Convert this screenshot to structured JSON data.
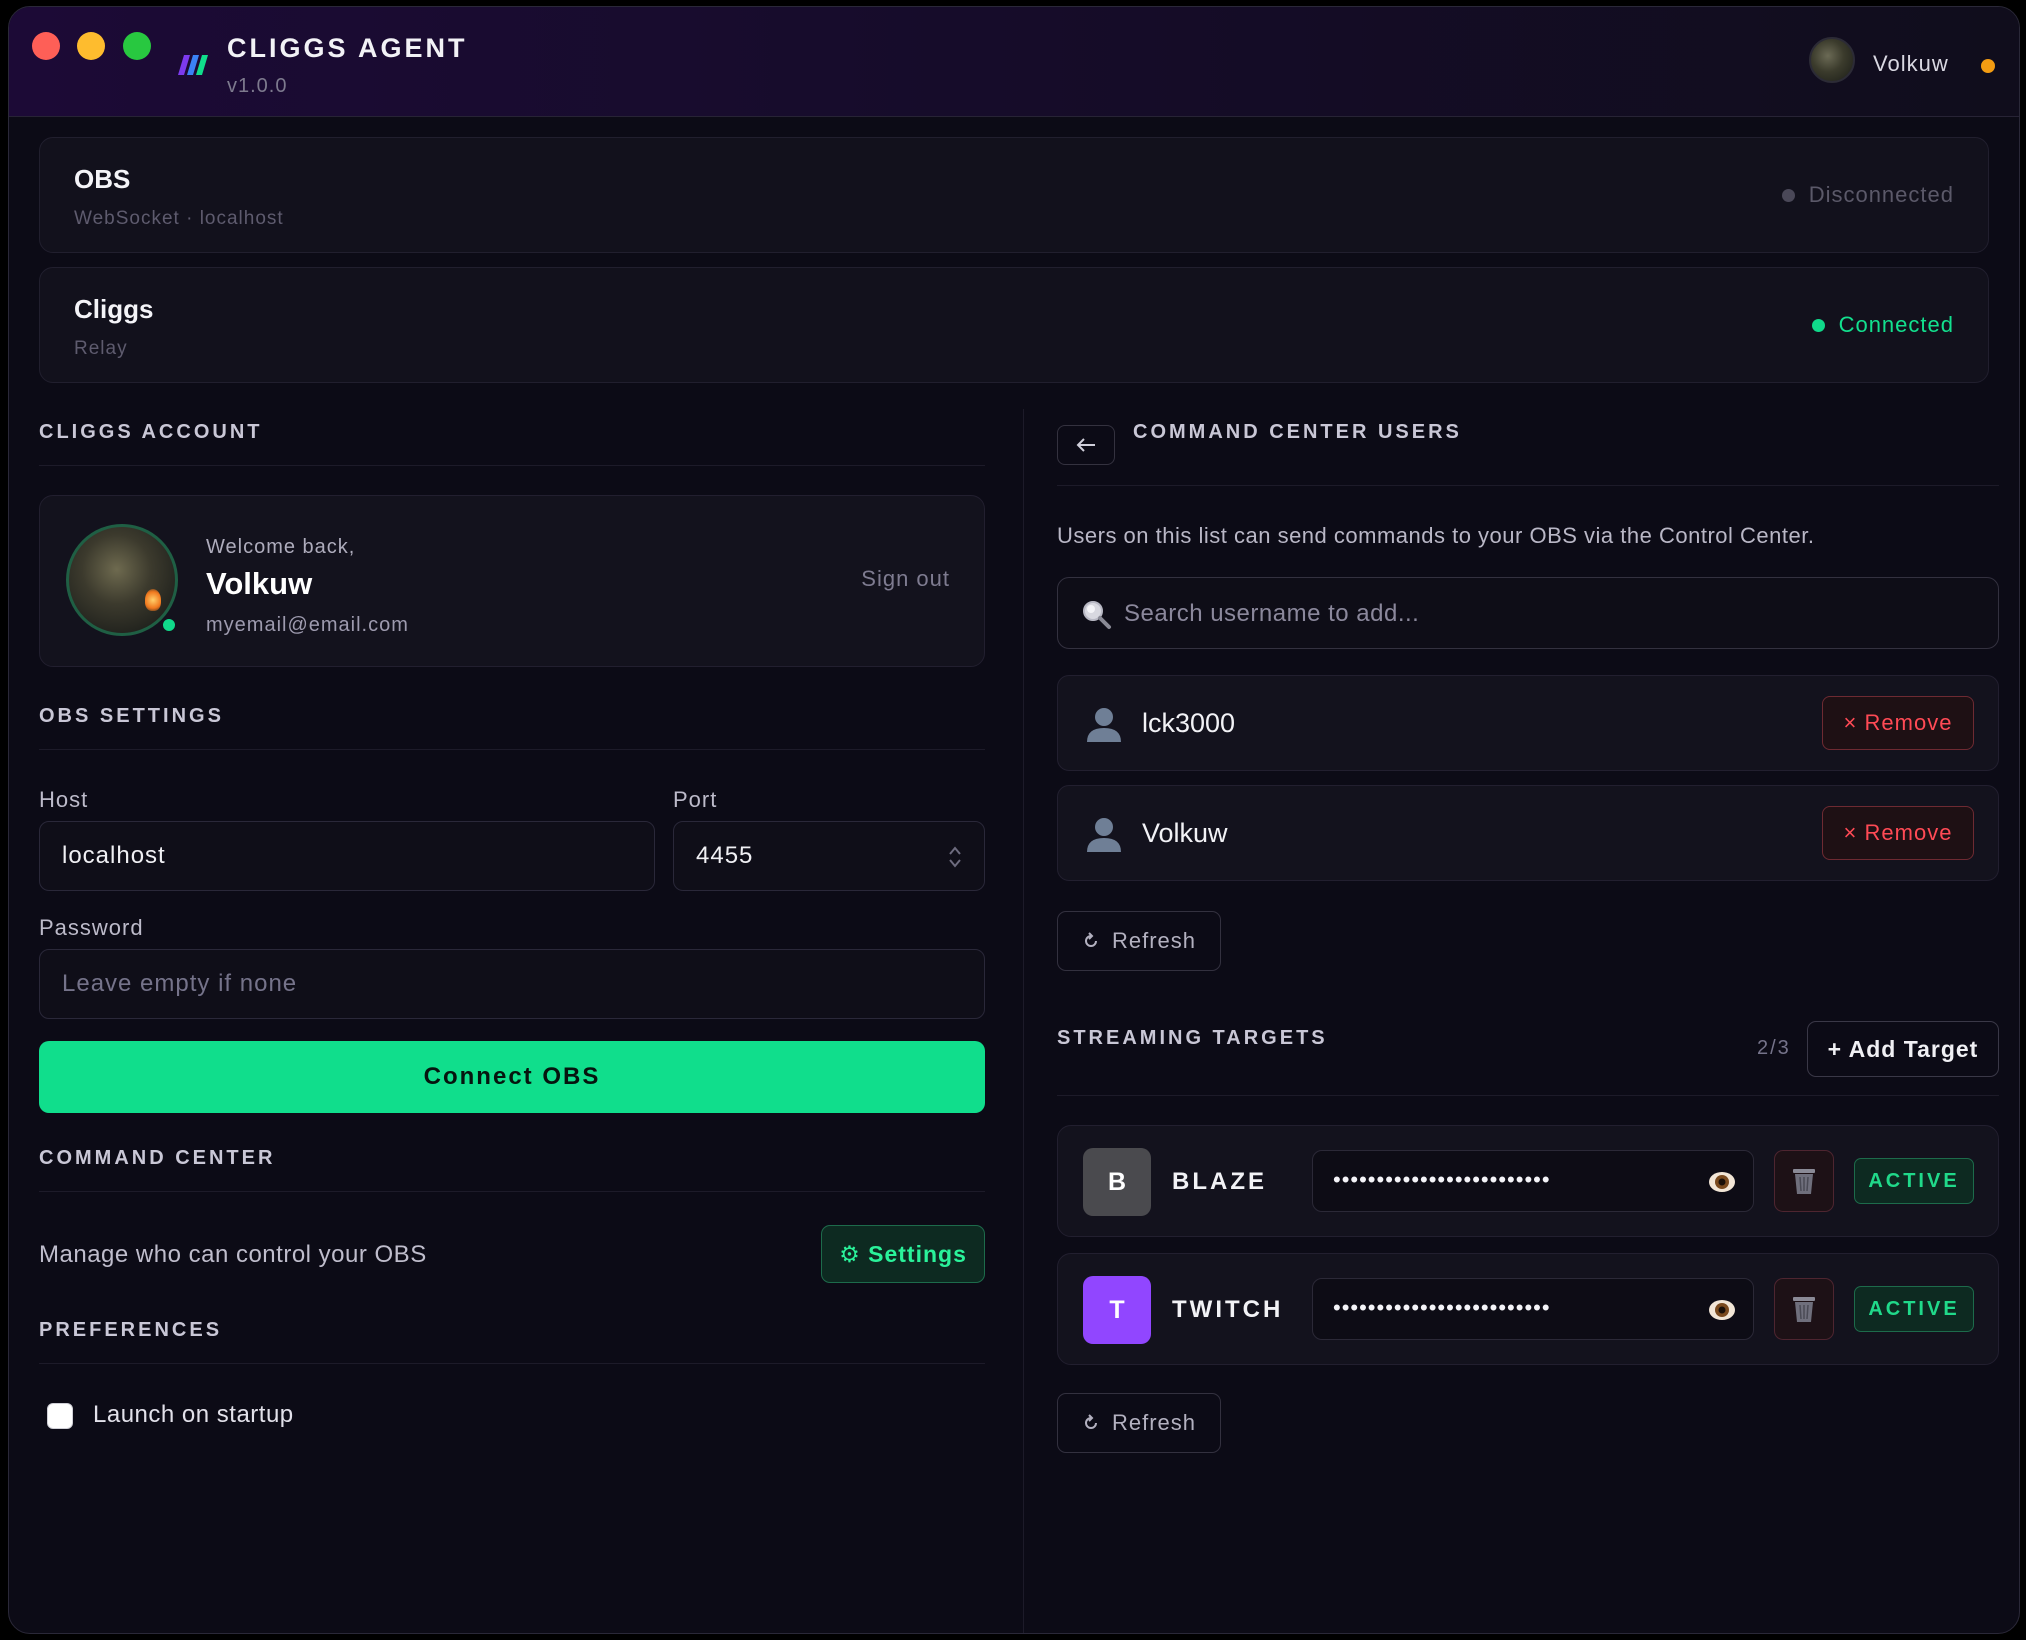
{
  "app": {
    "title": "CLIGGS AGENT",
    "version": "v1.0.0",
    "user": "Volkuw"
  },
  "colors": {
    "accent": "#10de8c",
    "danger": "#ff4a55",
    "warning": "#f39c12",
    "brand_purple": "#7c3aed"
  },
  "status": [
    {
      "name": "OBS",
      "sub": "WebSocket · localhost",
      "state": "Disconnected",
      "color": "#4a4858"
    },
    {
      "name": "Cliggs",
      "sub": "Relay",
      "state": "Connected",
      "color": "#10d98a"
    }
  ],
  "account": {
    "section_title": "CLIGGS ACCOUNT",
    "welcome": "Welcome back,",
    "name": "Volkuw",
    "email": "myemail@email.com",
    "signout": "Sign out"
  },
  "obs_settings": {
    "section_title": "OBS SETTINGS",
    "host_label": "Host",
    "host_value": "localhost",
    "port_label": "Port",
    "port_value": "4455",
    "password_label": "Password",
    "password_placeholder": "Leave empty if none",
    "connect_label": "Connect OBS"
  },
  "command_center": {
    "section_title": "COMMAND CENTER",
    "description": "Manage who can control your OBS",
    "settings_label": "⚙ Settings"
  },
  "preferences": {
    "section_title": "PREFERENCES",
    "launch_label": "Launch on startup",
    "launch_checked": false
  },
  "cc_users": {
    "section_title": "COMMAND CENTER USERS",
    "description": "Users on this list can send commands to your OBS via the Control Center.",
    "search_placeholder": "Search username to add...",
    "users": [
      "lck3000",
      "Volkuw"
    ],
    "remove_label": "× Remove",
    "refresh_label": "Refresh"
  },
  "streaming_targets": {
    "section_title": "STREAMING TARGETS",
    "count": "2/3",
    "add_label": "+ Add Target",
    "refresh_label": "Refresh",
    "targets": [
      {
        "badge": "B",
        "name": "BLAZE",
        "key_mask": "•••••••••••••••••••••••••",
        "status": "ACTIVE",
        "badge_color": "#4a4a4e"
      },
      {
        "badge": "T",
        "name": "TWITCH",
        "key_mask": "•••••••••••••••••••••••••",
        "status": "ACTIVE",
        "badge_color": "#9146ff"
      }
    ]
  }
}
